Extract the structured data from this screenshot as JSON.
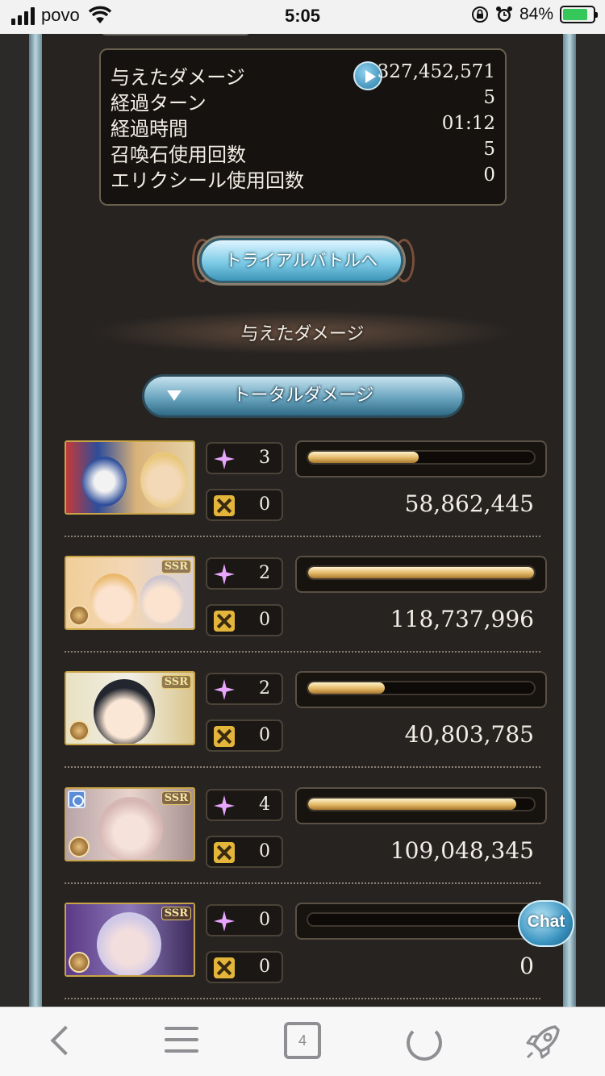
{
  "status_bar": {
    "carrier": "povo",
    "time": "5:05",
    "battery": "84%"
  },
  "summary": {
    "rows": [
      {
        "label": "与えたダメージ",
        "value": "327,452,571"
      },
      {
        "label": "経過ターン",
        "value": "5"
      },
      {
        "label": "経過時間",
        "value": "01:12"
      },
      {
        "label": "召喚石使用回数",
        "value": "5"
      },
      {
        "label": "エリクシール使用回数",
        "value": "0"
      }
    ]
  },
  "trial_button": "トライアルバトルへ",
  "section_title": "与えたダメージ",
  "total_damage_button": "トータルダメージ",
  "ssr_badge": "SSR",
  "members": [
    {
      "ability": "3",
      "ougi": "0",
      "damage": "58,862,445",
      "fill": 0.49
    },
    {
      "ability": "2",
      "ougi": "0",
      "damage": "118,737,996",
      "fill": 1.0
    },
    {
      "ability": "2",
      "ougi": "0",
      "damage": "40,803,785",
      "fill": 0.34
    },
    {
      "ability": "4",
      "ougi": "0",
      "damage": "109,048,345",
      "fill": 0.92
    },
    {
      "ability": "0",
      "ougi": "0",
      "damage": "0",
      "fill": 0.0
    }
  ],
  "chat_button": "Chat",
  "toolbar": {
    "tab_count": "4"
  }
}
